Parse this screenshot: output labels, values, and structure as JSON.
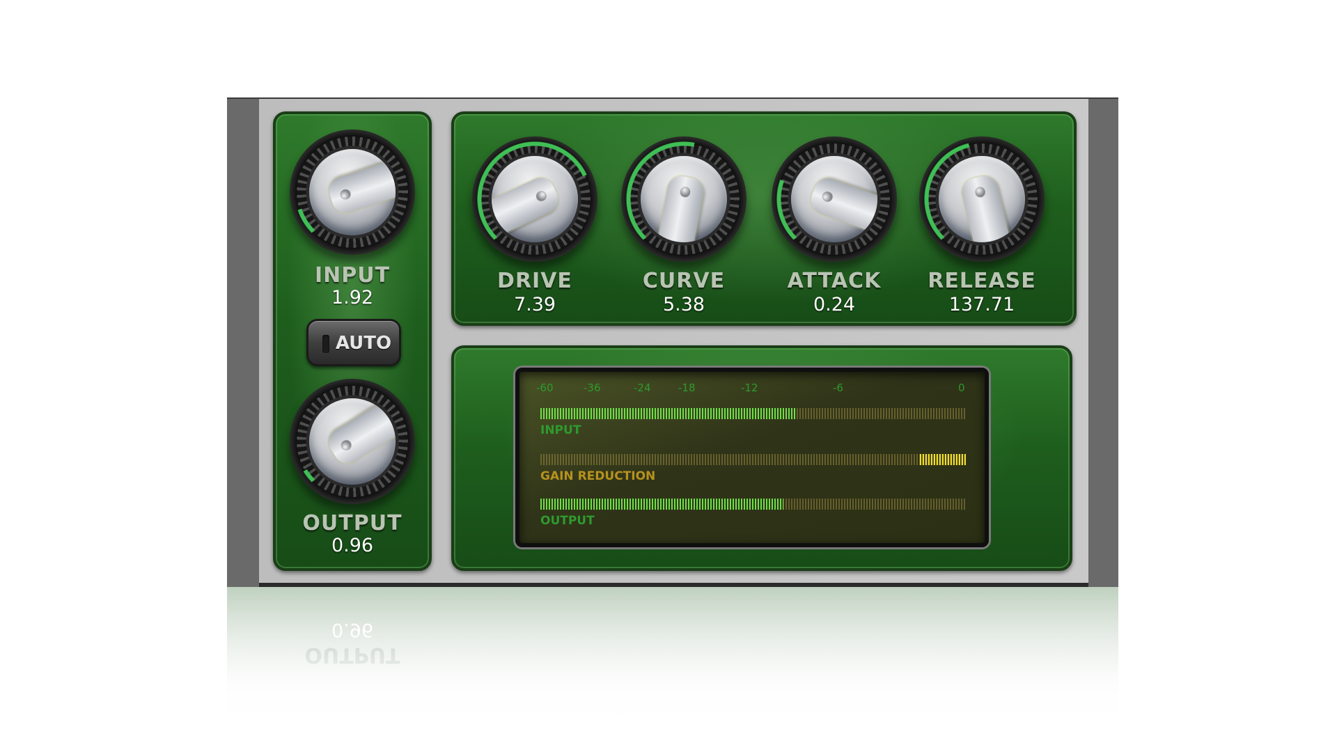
{
  "knobs": {
    "input": {
      "label": "INPUT",
      "value": "1.92",
      "level": 0.1
    },
    "output": {
      "label": "OUTPUT",
      "value": "0.96",
      "level": 0.05
    },
    "drive": {
      "label": "DRIVE",
      "value": "7.39",
      "level": 0.74
    },
    "curve": {
      "label": "CURVE",
      "value": "5.38",
      "level": 0.54
    },
    "attack": {
      "label": "ATTACK",
      "value": "0.24",
      "level": 0.24
    },
    "release": {
      "label": "RELEASE",
      "value": "137.71",
      "level": 0.45
    }
  },
  "auto_button": {
    "label": "AUTO",
    "active": false
  },
  "meter": {
    "scale": [
      "-60",
      "-36",
      "-24",
      "-18",
      "-12",
      "-6",
      "0"
    ],
    "input": {
      "label": "INPUT",
      "level": 0.6
    },
    "gain_reduction": {
      "label": "GAIN REDUCTION",
      "level": 0.11
    },
    "output": {
      "label": "OUTPUT",
      "level": 0.57
    }
  },
  "colors": {
    "panel_green": "#1e5e1d",
    "meter_green": "#6fe04a",
    "gain_reduction_yellow": "#f2e02a",
    "input_label": "#2e9a2e",
    "gain_reduction_label": "#b7921e"
  }
}
